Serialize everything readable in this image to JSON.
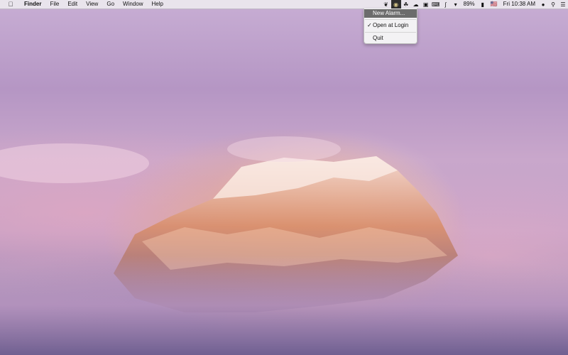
{
  "menubar": {
    "apple": "",
    "app_name": "Finder",
    "menus": [
      "File",
      "Edit",
      "View",
      "Go",
      "Window",
      "Help"
    ],
    "status_icons": [
      "leaf-icon",
      "alarm-clock-icon",
      "ghost-icon",
      "cloud-icon",
      "lock-icon",
      "keyboard-icon",
      "bluetooth-icon",
      "wifi-icon"
    ],
    "battery_percent": "89%",
    "flag": "🇺🇸",
    "clock": "Fri 10:38 AM"
  },
  "dropdown": {
    "items": [
      {
        "label": "New Alarm...",
        "checked": false,
        "highlighted": true
      },
      {
        "label": "Open at Login",
        "checked": true,
        "highlighted": false
      },
      {
        "label": "Quit",
        "checked": false,
        "highlighted": false
      }
    ],
    "checkmark": "✓"
  }
}
